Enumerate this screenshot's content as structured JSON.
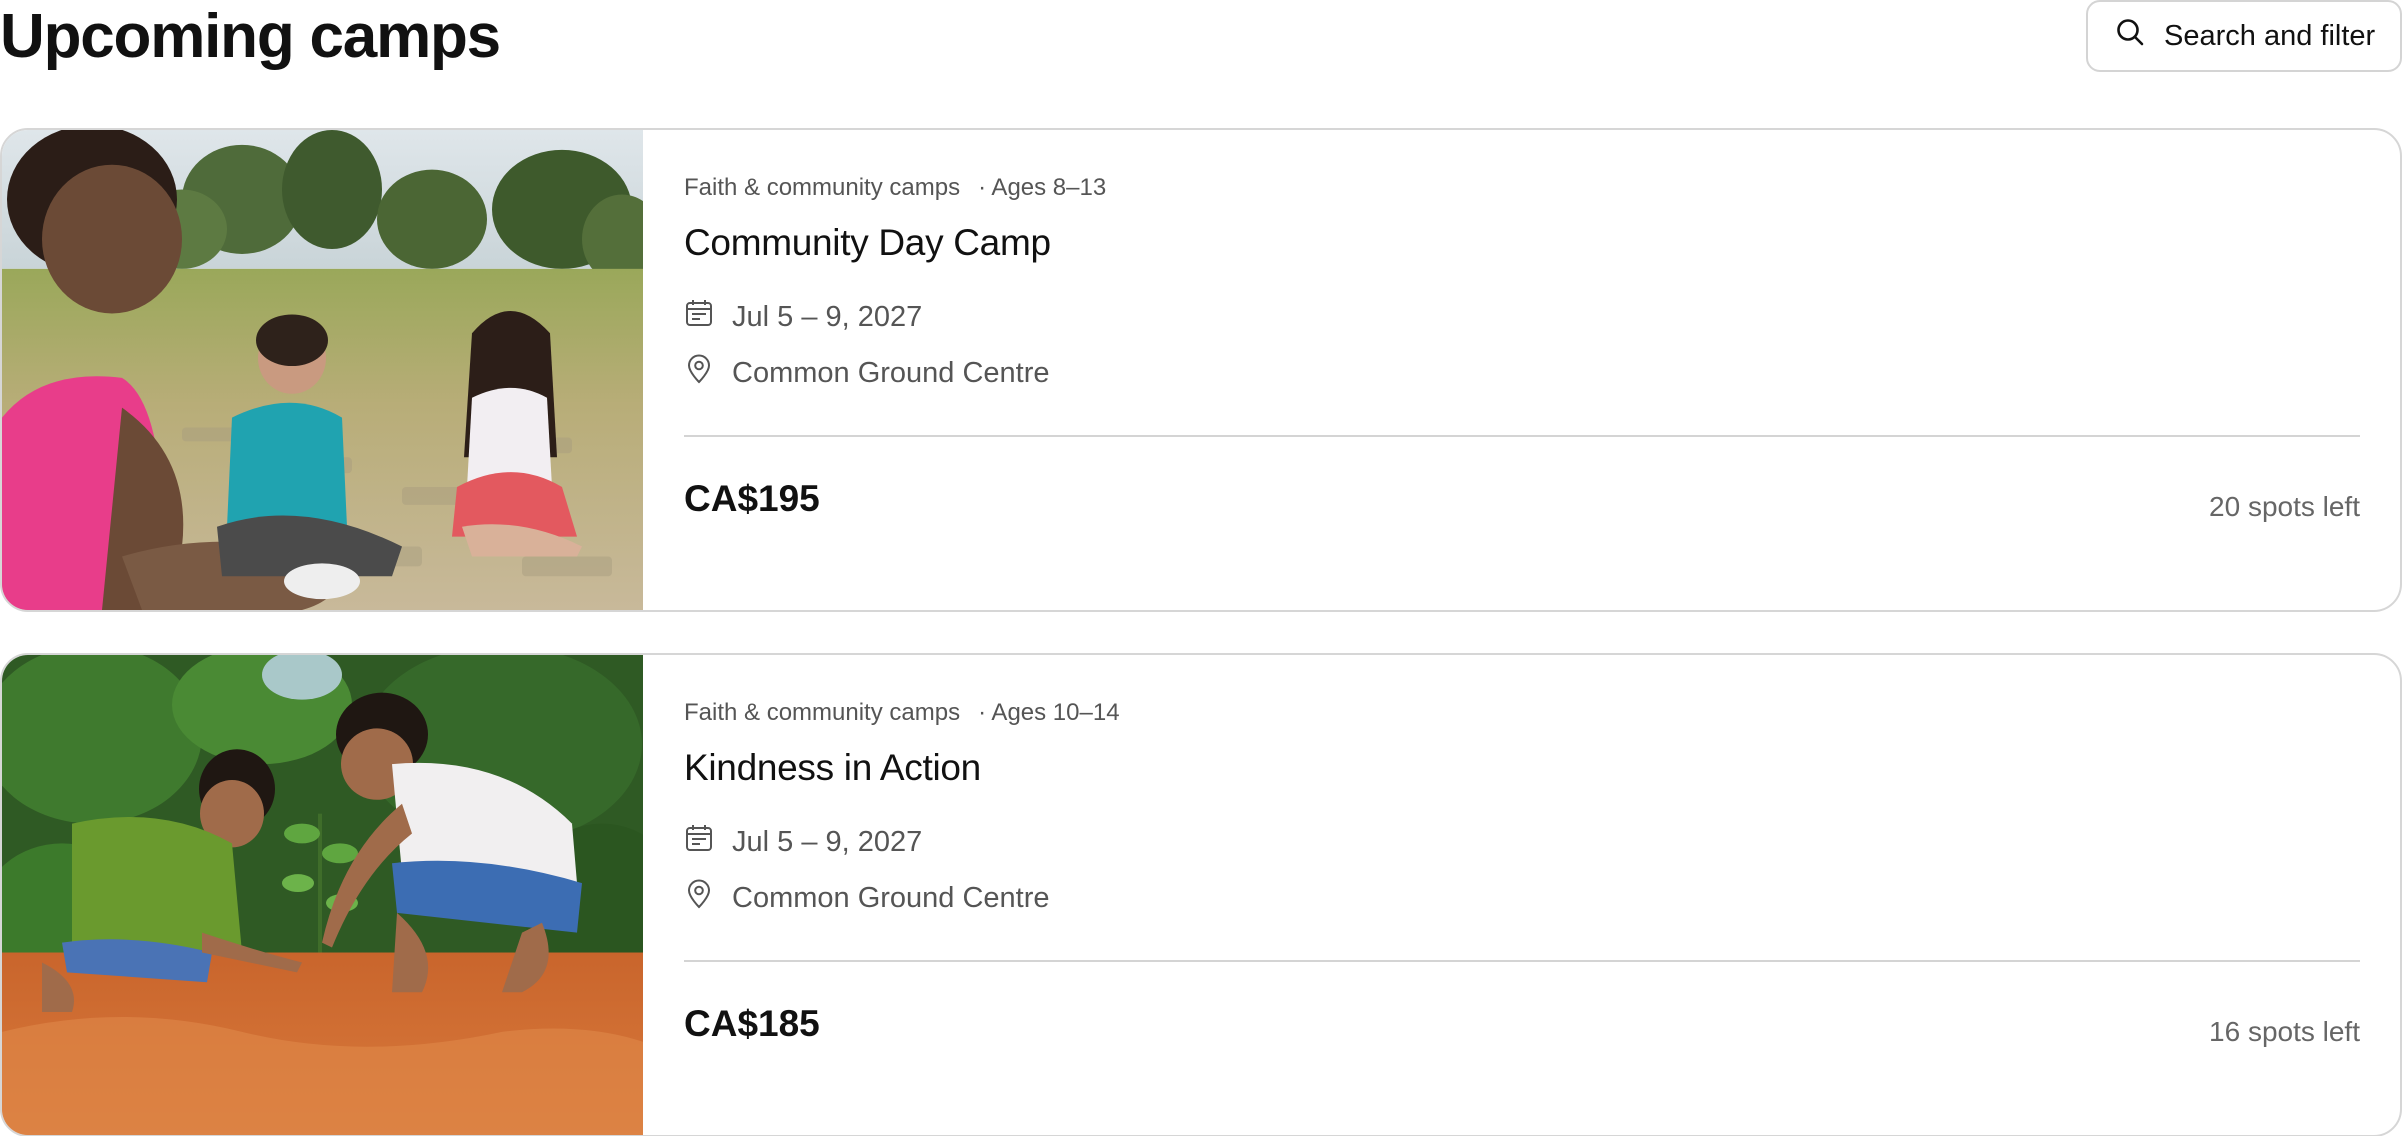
{
  "header": {
    "title": "Upcoming camps",
    "search_label": "Search and filter"
  },
  "icons": {
    "search": "search-icon",
    "calendar": "calendar-icon",
    "location": "location-pin-icon"
  },
  "camps": [
    {
      "category": "Faith & community camps",
      "ages": "· Ages 8–13",
      "title": "Community Day Camp",
      "dates": "Jul 5 – 9, 2027",
      "location": "Common Ground Centre",
      "price": "CA$195",
      "spots": "20 spots left"
    },
    {
      "category": "Faith & community camps",
      "ages": "· Ages 10–14",
      "title": "Kindness in Action",
      "dates": "Jul 5 – 9, 2027",
      "location": "Common Ground Centre",
      "price": "CA$185",
      "spots": "16 spots left"
    }
  ],
  "colors": {
    "border": "#d6d6d6",
    "muted_text": "#555555",
    "primary_text": "#111111"
  }
}
